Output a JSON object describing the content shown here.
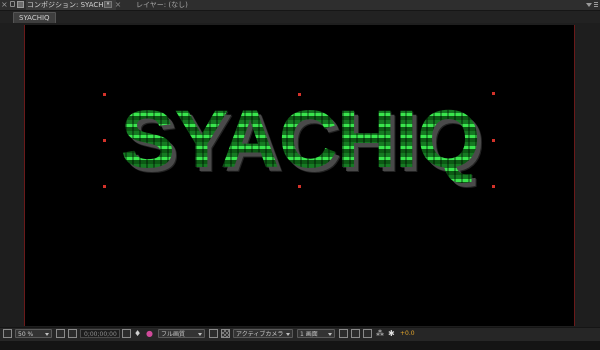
{
  "panel": {
    "comp_tab_label": "コンポジション: SYACHIQ",
    "layer_tab_label": "レイヤー: (なし)"
  },
  "breadcrumb": {
    "label": "SYACHIQ"
  },
  "viewer": {
    "composition_text": "SYACHIQ",
    "text_color": "#27c83a"
  },
  "toolbar": {
    "magnification": "50 %",
    "timecode": "0;00;00;00",
    "resolution": "フル画質",
    "camera": "アクティブカメラ",
    "view_layout": "1 画面",
    "exposure": "+0.0"
  }
}
